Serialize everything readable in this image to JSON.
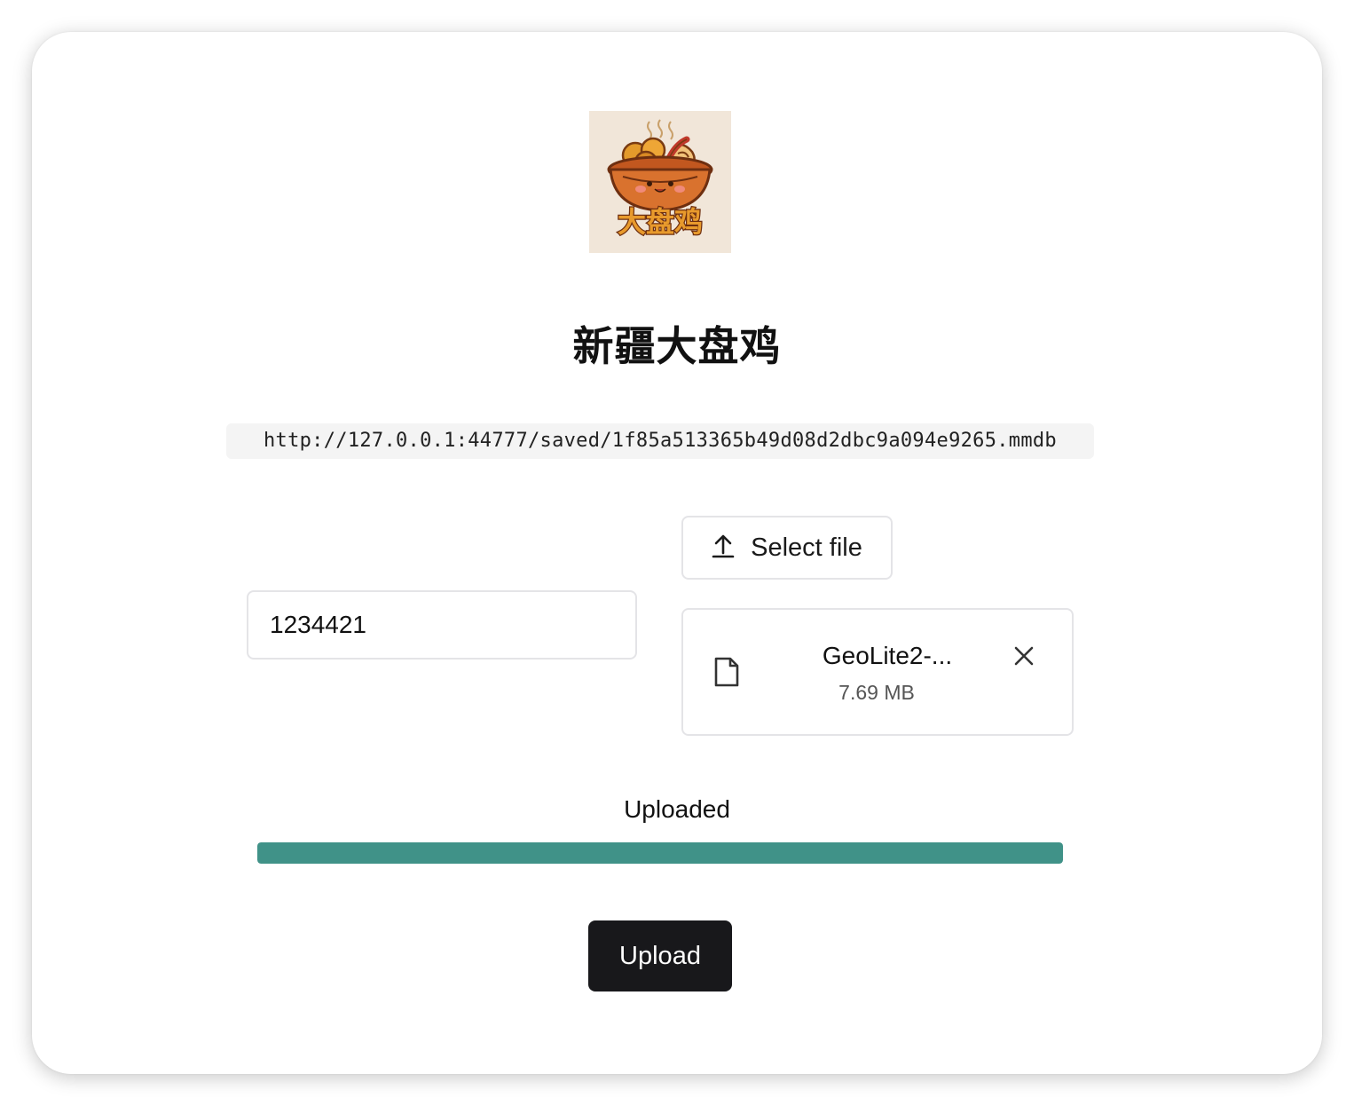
{
  "app": {
    "title": "新疆大盘鸡",
    "logo_icon": "dapanji-logo",
    "logo_text": "大盘鸡"
  },
  "url": "http://127.0.0.1:44777/saved/1f85a513365b49d08d2dbc9a094e9265.mmdb",
  "form": {
    "input_value": "1234421",
    "select_file": {
      "label": "Select file",
      "icon": "upload-icon"
    },
    "file": {
      "icon": "file-icon",
      "name": "GeoLite2-...",
      "size": "7.69 MB",
      "remove_icon": "close-icon"
    },
    "status": "Uploaded",
    "progress_percent": 100,
    "progress_color": "#409288",
    "upload_label": "Upload"
  }
}
